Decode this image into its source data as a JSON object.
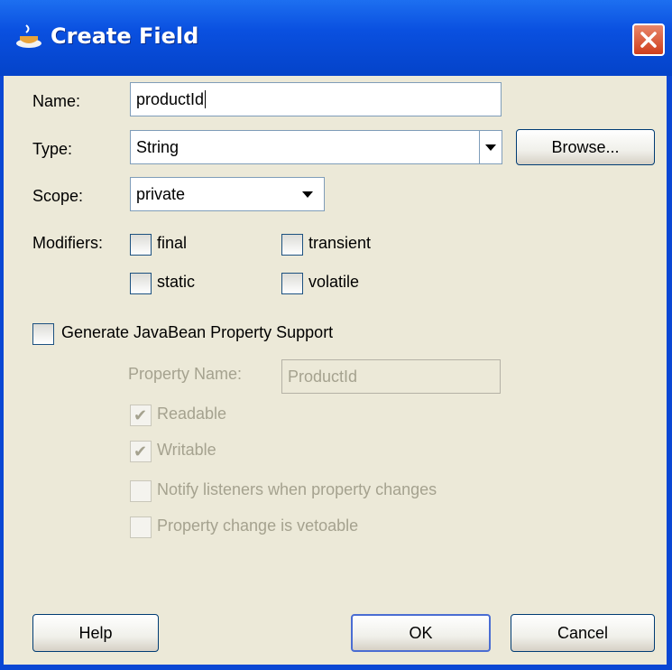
{
  "dialog": {
    "title": "Create Field"
  },
  "name_field": {
    "label": "Name:",
    "value": "productId"
  },
  "type_field": {
    "label": "Type:",
    "value": "String",
    "browse_label": "Browse..."
  },
  "scope_field": {
    "label": "Scope:",
    "value": "private"
  },
  "modifiers": {
    "label": "Modifiers:",
    "final": "final",
    "transient": "transient",
    "static": "static",
    "volatile": "volatile"
  },
  "javabean": {
    "generate_label": "Generate JavaBean Property Support",
    "property_name_label": "Property Name:",
    "property_name_value": "ProductId",
    "readable": "Readable",
    "writable": "Writable",
    "notify": "Notify listeners when property changes",
    "vetoable": "Property change is vetoable"
  },
  "buttons": {
    "help": "Help",
    "ok": "OK",
    "cancel": "Cancel"
  },
  "colors": {
    "titlebar": "#0a50e0",
    "dialog_bg": "#ece9d8",
    "disabled_text": "#a5a28f"
  }
}
